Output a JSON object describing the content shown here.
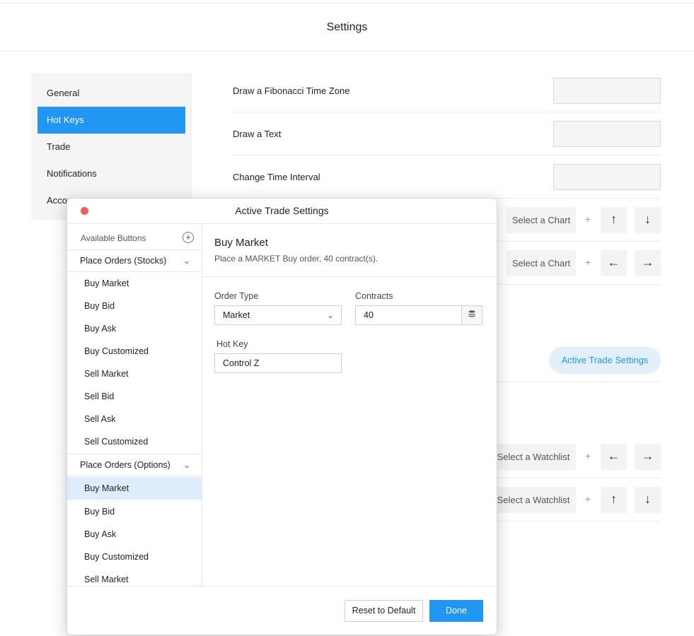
{
  "page": {
    "title": "Settings"
  },
  "sidebar": {
    "items": [
      {
        "label": "General"
      },
      {
        "label": "Hot Keys"
      },
      {
        "label": "Trade"
      },
      {
        "label": "Notifications"
      },
      {
        "label": "Accou"
      }
    ]
  },
  "rows": {
    "fib": {
      "label": "Draw a Fibonacci Time Zone",
      "value": ""
    },
    "text": {
      "label": "Draw a Text",
      "value": ""
    },
    "interval": {
      "label": "Change Time Interval",
      "value": ""
    },
    "chart_row1": {
      "select": "Select a Chart",
      "plus": "+",
      "a": "↑",
      "b": "↓"
    },
    "chart_row2": {
      "select": "Select a Chart",
      "plus": "+",
      "a": "←",
      "b": "→"
    },
    "ats_button": "Active Trade Settings",
    "watch_row1": {
      "select": "Select a Watchlist",
      "plus": "+",
      "a": "←",
      "b": "→"
    },
    "watch_row2": {
      "select": "Select a Watchlist",
      "plus": "+",
      "a": "↑",
      "b": "↓"
    }
  },
  "modal": {
    "title": "Active Trade Settings",
    "available_label": "Available Buttons",
    "add_icon": "+",
    "groups": [
      {
        "label": "Place Orders (Stocks)",
        "chevron": "⌄",
        "items": [
          "Buy Market",
          "Buy Bid",
          "Buy Ask",
          "Buy Customized",
          "Sell Market",
          "Sell Bid",
          "Sell Ask",
          "Sell Customized"
        ]
      },
      {
        "label": "Place Orders (Options)",
        "chevron": "⌄",
        "items": [
          "Buy Market",
          "Buy Bid",
          "Buy Ask",
          "Buy Customized",
          "Sell Market"
        ]
      }
    ],
    "detail": {
      "title": "Buy Market",
      "description": "Place a MARKET Buy order, 40 contract(s).",
      "order_type_label": "Order Type",
      "order_type_value": "Market",
      "contracts_label": "Contracts",
      "contracts_value": "40",
      "hotkey_label": "Hot Key",
      "hotkey_value": "Control Z"
    },
    "footer": {
      "reset": "Reset to Default",
      "done": "Done"
    }
  },
  "colors": {
    "accent": "#2196f3",
    "accent_light": "#e3f0fc",
    "close": "#f25c54",
    "selected_row": "#deedfc"
  }
}
